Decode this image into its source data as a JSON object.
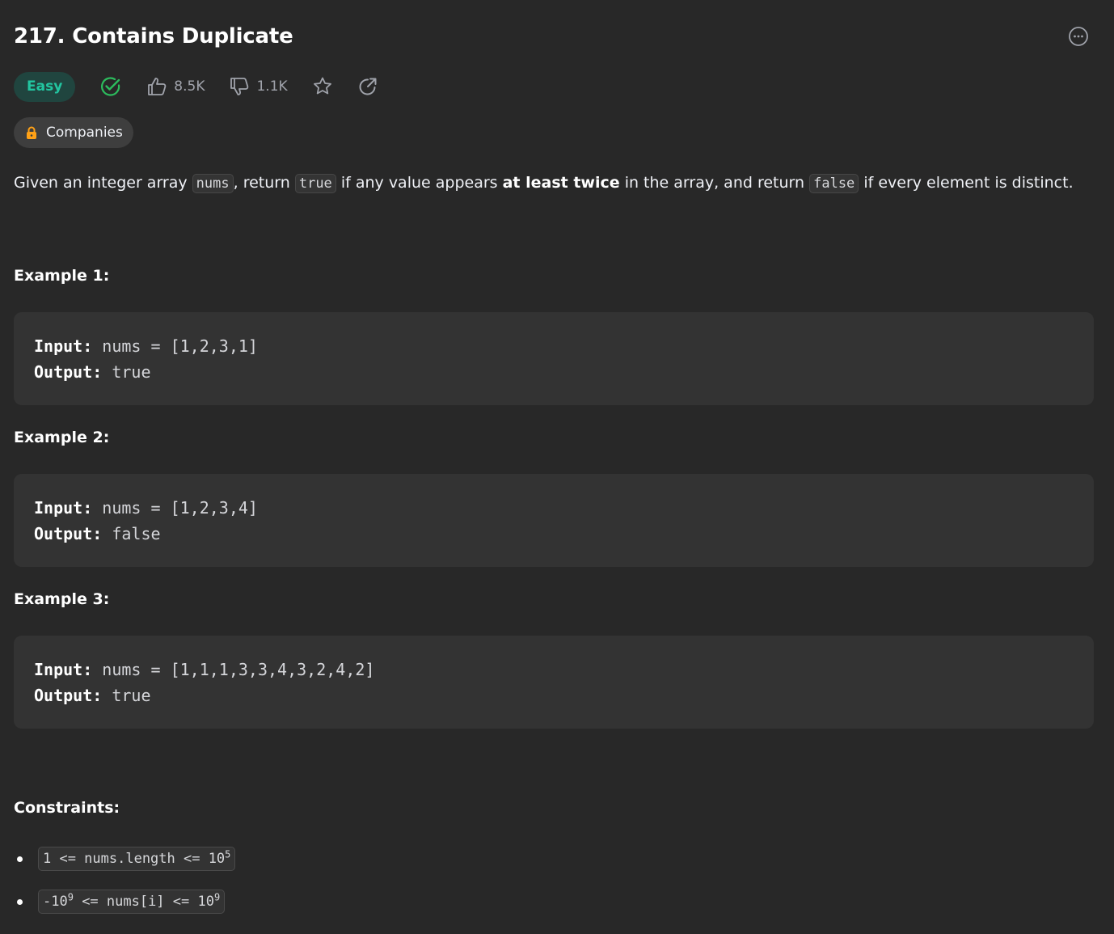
{
  "problem": {
    "title": "217. Contains Duplicate",
    "difficulty": "Easy",
    "likes": "8.5K",
    "dislikes": "1.1K",
    "companies_label": "Companies"
  },
  "description": {
    "p1": "Given an integer array ",
    "c1": "nums",
    "p2": ", return ",
    "c2": "true",
    "p3": " if any value appears ",
    "bold": "at least twice",
    "p4": " in the array, and return ",
    "c3": "false",
    "p5": " if every element is distinct."
  },
  "examples": [
    {
      "title": "Example 1:",
      "input_label": "Input:",
      "input": "nums = [1,2,3,1]",
      "output_label": "Output:",
      "output": "true"
    },
    {
      "title": "Example 2:",
      "input_label": "Input:",
      "input": "nums = [1,2,3,4]",
      "output_label": "Output:",
      "output": "false"
    },
    {
      "title": "Example 3:",
      "input_label": "Input:",
      "input": "nums = [1,1,1,3,3,4,3,2,4,2]",
      "output_label": "Output:",
      "output": "true"
    }
  ],
  "constraints": {
    "title": "Constraints:",
    "c1_pre": "1 <= nums.length <= 10",
    "c1_exp": "5",
    "c2_pre": "-10",
    "c2_exp1": "9",
    "c2_mid": " <= nums[i] <= 10",
    "c2_exp2": "9"
  },
  "colors": {
    "background": "#282828",
    "easy": "#22c5a0",
    "solved_check": "#2cbb5d",
    "lock": "#ffa116"
  },
  "icons": [
    "more-icon",
    "solved-check-icon",
    "thumbs-up-icon",
    "thumbs-down-icon",
    "star-icon",
    "share-icon",
    "lock-icon"
  ]
}
